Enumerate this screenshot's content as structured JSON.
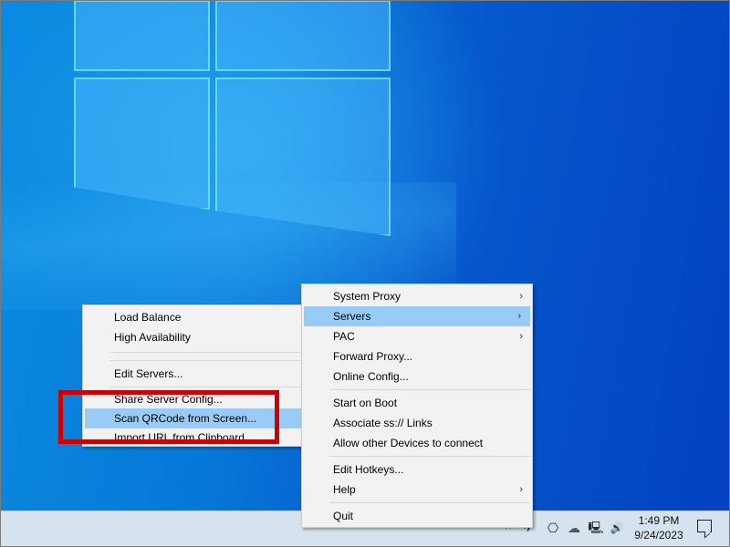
{
  "desktop": {
    "wallpaper": "Windows 10 light-blue window logo"
  },
  "main_menu": {
    "items": [
      {
        "label": "System Proxy",
        "has_submenu": true
      },
      {
        "label": "Servers",
        "has_submenu": true,
        "selected": true
      },
      {
        "label": "PAC",
        "has_submenu": true
      },
      {
        "label": "Forward Proxy..."
      },
      {
        "label": "Online Config..."
      },
      {
        "separator": true
      },
      {
        "label": "Start on Boot"
      },
      {
        "label": "Associate ss:// Links"
      },
      {
        "label": "Allow other Devices to connect"
      },
      {
        "separator": true
      },
      {
        "label": "Edit Hotkeys..."
      },
      {
        "label": "Help",
        "has_submenu": true
      },
      {
        "separator": true
      },
      {
        "label": "Quit"
      }
    ],
    "arrow_glyph": "›"
  },
  "servers_submenu": {
    "items": [
      {
        "label": "Load Balance"
      },
      {
        "label": "High Availability"
      },
      {
        "separator": true
      },
      {
        "separator": true
      },
      {
        "label": "Edit Servers..."
      },
      {
        "separator": true
      },
      {
        "label": "Share Server Config..."
      },
      {
        "label": "Scan QRCode from Screen...",
        "selected": true
      },
      {
        "label": "Import URL from Clipboard..."
      }
    ]
  },
  "annotation": {
    "type": "highlight-rectangle",
    "color": "#cc0000",
    "target": "Scan QRCode from Screen..."
  },
  "taskbar": {
    "tray_icons": [
      {
        "name": "chevron-up-icon",
        "glyph": "^"
      },
      {
        "name": "app-tray-icon",
        "glyph": "✈"
      },
      {
        "name": "meet-now-icon",
        "glyph": "⎔"
      },
      {
        "name": "onedrive-icon",
        "glyph": "☁"
      },
      {
        "name": "network-icon",
        "glyph": "🖳"
      },
      {
        "name": "volume-icon",
        "glyph": "🔊"
      }
    ],
    "time": "1:49 PM",
    "date": "9/24/2023"
  },
  "colors": {
    "menu_bg": "#f2f2f2",
    "menu_selected": "#99cbf7",
    "taskbar_bg": "#d6e2ee",
    "highlight": "#cc0000"
  }
}
